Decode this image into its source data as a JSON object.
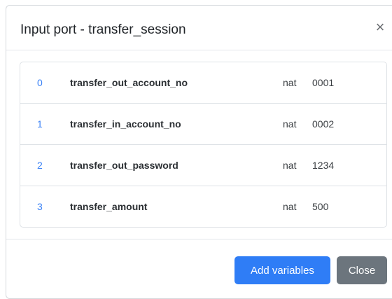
{
  "modal": {
    "title": "Input port - transfer_session",
    "close_glyph": "×",
    "close_icon": "close-icon"
  },
  "variables": [
    {
      "index": "0",
      "name": "transfer_out_account_no",
      "type": "nat",
      "value": "0001"
    },
    {
      "index": "1",
      "name": "transfer_in_account_no",
      "type": "nat",
      "value": "0002"
    },
    {
      "index": "2",
      "name": "transfer_out_password",
      "type": "nat",
      "value": "1234"
    },
    {
      "index": "3",
      "name": "transfer_amount",
      "type": "nat",
      "value": "500"
    }
  ],
  "footer": {
    "add_label": "Add variables",
    "close_label": "Close"
  },
  "colors": {
    "primary": "#2f7df6",
    "secondary": "#6c757d",
    "index_text": "#3b82f6"
  }
}
